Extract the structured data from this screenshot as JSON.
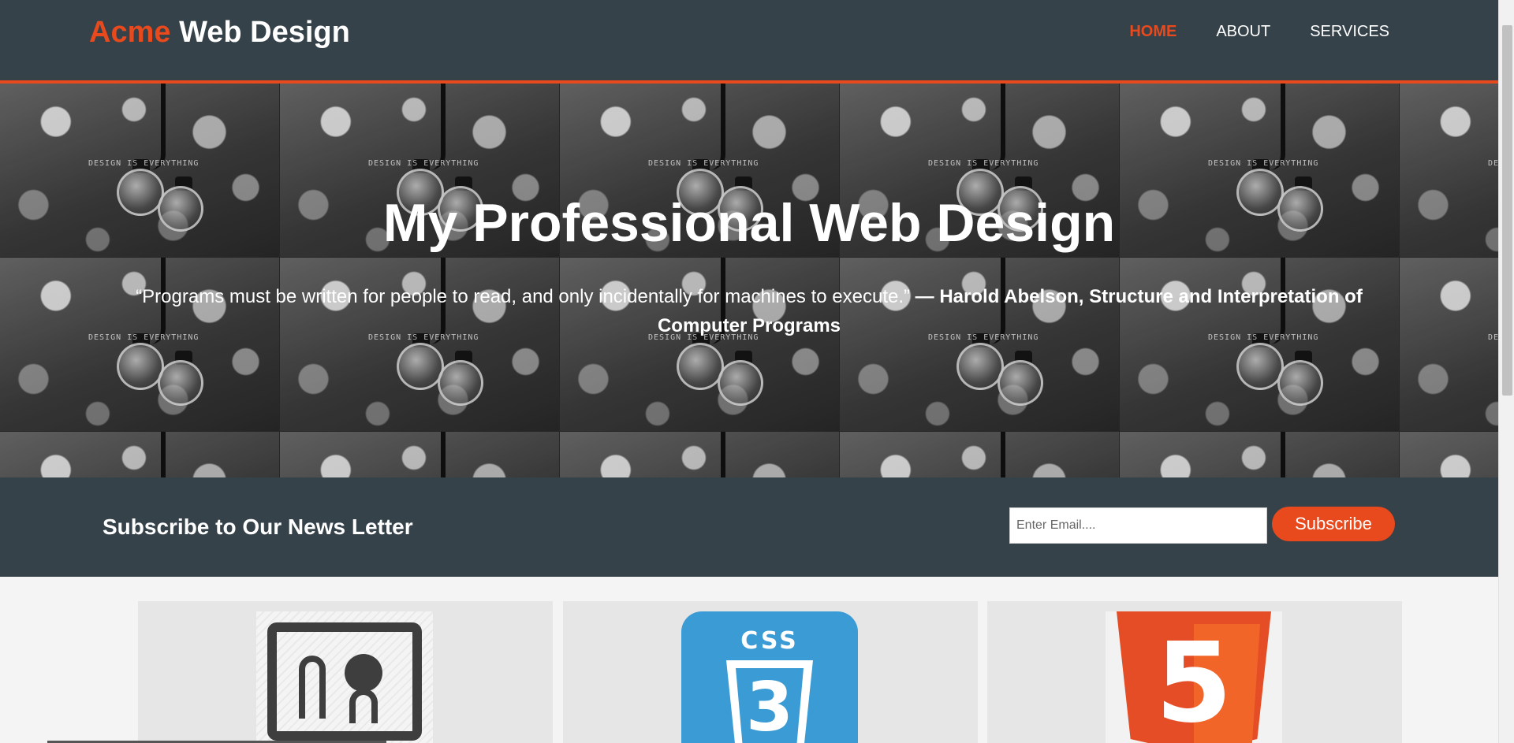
{
  "header": {
    "brand_accent": "Acme",
    "brand_rest": "Web Design",
    "nav": [
      {
        "label": "HOME",
        "active": true
      },
      {
        "label": "ABOUT",
        "active": false
      },
      {
        "label": "SERVICES",
        "active": false
      }
    ]
  },
  "showcase": {
    "title": "My Professional Web Design",
    "quote_text": "“Programs must be written for people to read, and only incidentally for machines to execute.”",
    "quote_author": "— Harold Abelson, Structure and Interpretation of Computer Programs",
    "background_text": "DESIGN IS EVERYTHING"
  },
  "newsletter": {
    "heading": "Subscribe to Our News Letter",
    "email_placeholder": "Enter Email....",
    "button_label": "Subscribe"
  },
  "boxes": [
    {
      "icon": "design-tablet-icon"
    },
    {
      "icon": "css3-logo-icon",
      "logo_text": "CSS",
      "logo_number": "3"
    },
    {
      "icon": "html5-logo-icon",
      "logo_number": "5"
    }
  ],
  "colors": {
    "primary_dark": "#35424a",
    "accent": "#e8491d",
    "background": "#f4f4f4",
    "box_background": "#e6e6e6",
    "css_blue": "#3a9bd5",
    "html_orange": "#e44d26"
  }
}
